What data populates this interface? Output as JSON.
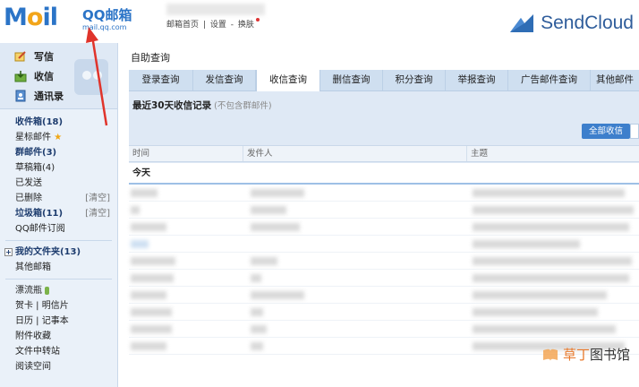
{
  "header": {
    "logo_mail": "Mail",
    "logo_brand": "QQ邮箱",
    "logo_domain": "mail.qq.com",
    "links": [
      "邮箱首页",
      "设置",
      "换肤"
    ],
    "sendcloud": "SendCloud"
  },
  "sidebar": {
    "quick": [
      "写信",
      "收信",
      "通讯录"
    ],
    "folders": [
      {
        "label": "收件箱(18)",
        "bold": true
      },
      {
        "label": "星标邮件",
        "star": true
      },
      {
        "label": "群邮件(3)",
        "bold": true
      },
      {
        "label": "草稿箱(4)"
      },
      {
        "label": "已发送"
      },
      {
        "label": "已删除",
        "clear": "[清空]"
      },
      {
        "label": "垃圾箱(11)",
        "bold": true,
        "clear": "[清空]"
      },
      {
        "label": "QQ邮件订阅"
      }
    ],
    "my_folders": "我的文件夹(13)",
    "other": "其他邮箱",
    "apps": [
      "漂流瓶",
      "贺卡 | 明信片",
      "日历 | 记事本",
      "附件收藏",
      "文件中转站",
      "阅读空间"
    ]
  },
  "main": {
    "title": "自助查询",
    "tabs": [
      "登录查询",
      "发信查询",
      "收信查询",
      "删信查询",
      "积分查询",
      "举报查询",
      "广告邮件查询",
      "其他邮件"
    ],
    "active_tab": 2,
    "panel_title": "最近30天收信记录",
    "panel_sub": "(不包含群邮件)",
    "all_button": "全部收信",
    "columns": [
      "时间",
      "发件人",
      "主题"
    ],
    "group": "今天"
  },
  "watermark": {
    "a": "草丁",
    "b": "图书馆"
  },
  "colors": {
    "accent": "#3d7fcc",
    "panel": "#dfe9f5",
    "annotation": "#e0342b"
  }
}
